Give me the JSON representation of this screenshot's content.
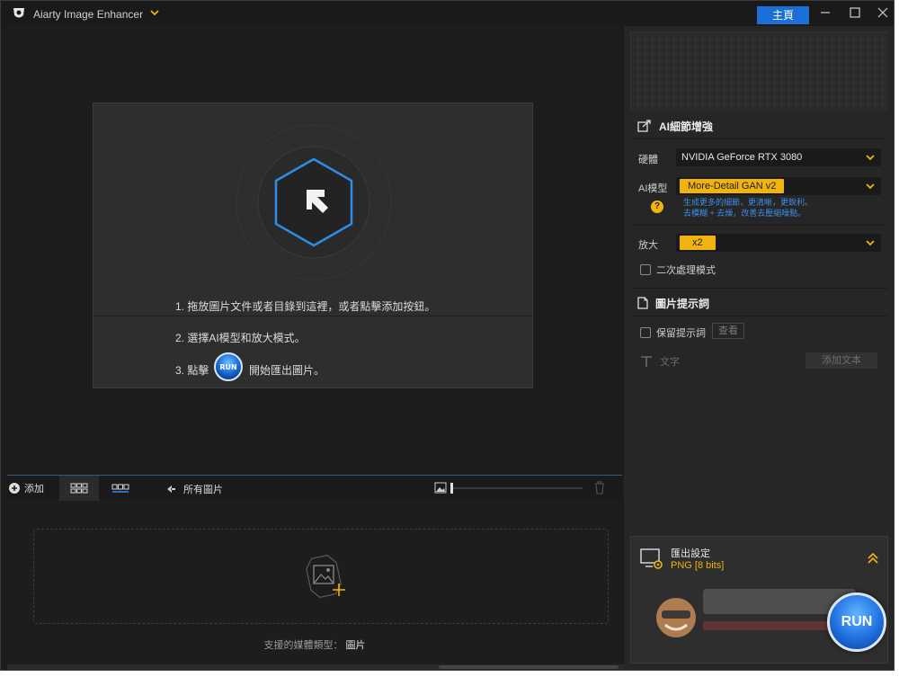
{
  "titlebar": {
    "app_title": "Aiarty Image Enhancer",
    "home_label": "主頁"
  },
  "canvas": {
    "instructions": {
      "step1": "1. 拖放圖片文件或者目錄到這裡，或者點擊添加按鈕。",
      "step2": "2. 選擇AI模型和放大模式。",
      "step3_prefix": "3. 點擊",
      "step3_run": "RUN",
      "step3_suffix": "開始匯出圖片。"
    }
  },
  "toolbar": {
    "add_label": "添加",
    "all_images_label": "所有圖片"
  },
  "thumbs": {
    "supported_label": "支援的媒體類型：",
    "supported_value": "圖片"
  },
  "panel": {
    "ai_section_title": "AI細節增強",
    "hardware_label": "硬體",
    "hardware_value": "NVIDIA GeForce RTX 3080",
    "model_label": "AI模型",
    "model_value": "More-Detail GAN v2",
    "help_glyph": "?",
    "model_desc_line1": "生成更多的細節，更清晰，更銳利。",
    "model_desc_line2": "去模糊 + 去燥，改善去壓縮噪點。",
    "scale_label": "放大",
    "scale_value": "x2",
    "second_pass_label": "二次處理模式",
    "prompt_section_title": "圖片提示詞",
    "keep_prompt_label": "保留提示詞",
    "view_label": "查看",
    "text_label": "文字",
    "add_text_label": "添加文本",
    "export_title": "匯出設定",
    "export_format": "PNG  [8 bits]",
    "run_label": "RUN"
  },
  "colors": {
    "accent_blue": "#1b6fd6",
    "accent_yellow": "#f1b40f",
    "hex_blue": "#2f8be8"
  }
}
